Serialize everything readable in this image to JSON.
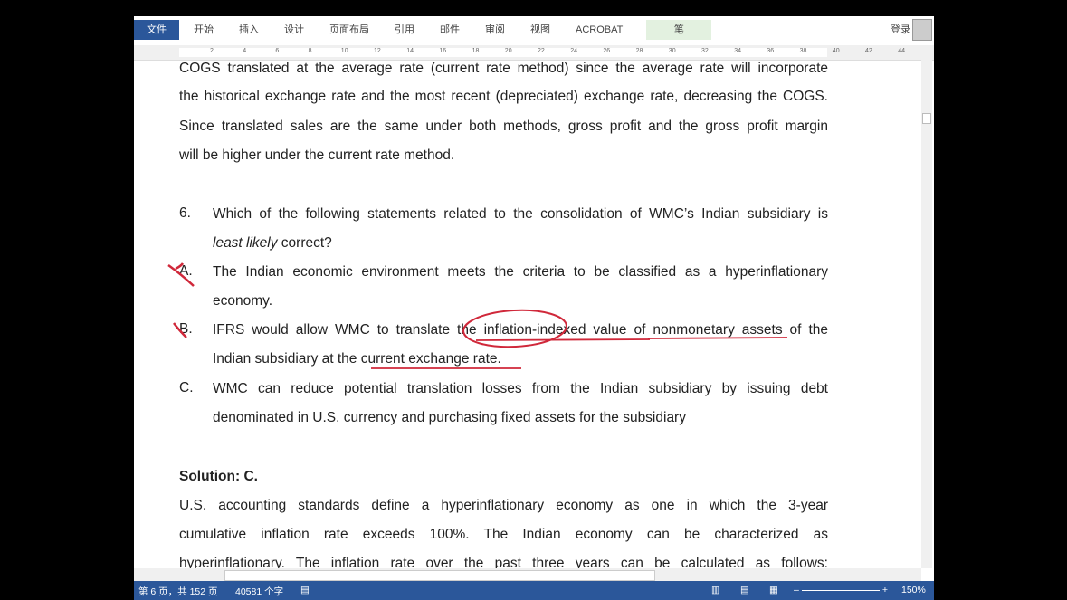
{
  "ribbon": {
    "tabs": [
      "文件",
      "开始",
      "插入",
      "设计",
      "页面布局",
      "引用",
      "邮件",
      "审阅",
      "视图",
      "ACROBAT",
      "笔"
    ],
    "login": "登录"
  },
  "ruler": {
    "ticks": [
      "2",
      "4",
      "6",
      "8",
      "10",
      "12",
      "14",
      "16",
      "18",
      "20",
      "22",
      "24",
      "26",
      "28",
      "30",
      "32",
      "34",
      "36",
      "38",
      "40",
      "42",
      "44"
    ]
  },
  "document": {
    "para1": [
      "COGS translated at the average rate (current rate method) since the average rate will incorporate",
      "the historical exchange rate and the most recent (depreciated) exchange rate, decreasing the COGS.",
      "Since translated sales are the same under both methods, gross profit and the gross profit margin",
      "will be higher under the current rate method."
    ],
    "q_num": "6.",
    "q_line1": "Which of the following statements related to the consolidation of WMC’s Indian subsidiary is",
    "q_line2_italic": "least likely",
    "q_line2_rest": " correct?",
    "options": [
      {
        "letter": "A.",
        "lines": [
          "The Indian economic environment meets the criteria to be classified as a hyperinflationary",
          "economy."
        ]
      },
      {
        "letter": "B.",
        "lines": [
          "IFRS would allow WMC to translate the inflation-indexed value of nonmonetary assets of the",
          "Indian subsidiary at the current exchange rate."
        ]
      },
      {
        "letter": "C.",
        "lines": [
          "WMC can reduce potential translation losses from the Indian subsidiary by issuing debt",
          "denominated in U.S. currency and purchasing fixed assets for the subsidiary"
        ]
      }
    ],
    "solution": "Solution: C.",
    "para2": [
      "U.S. accounting standards define a hyperinflationary economy as one in which the 3-year",
      "cumulative inflation rate exceeds 100%. The Indian economy can be characterized as",
      "hyperinflationary. The inflation rate over the past three years can be calculated as follows:"
    ]
  },
  "status": {
    "page": "第 6 页，共 152 页",
    "words": "40581 个字",
    "zoom": "150%",
    "zoom_level_percent": 150
  },
  "colors": {
    "accent": "#2b579a",
    "ink": "#d0283a"
  }
}
